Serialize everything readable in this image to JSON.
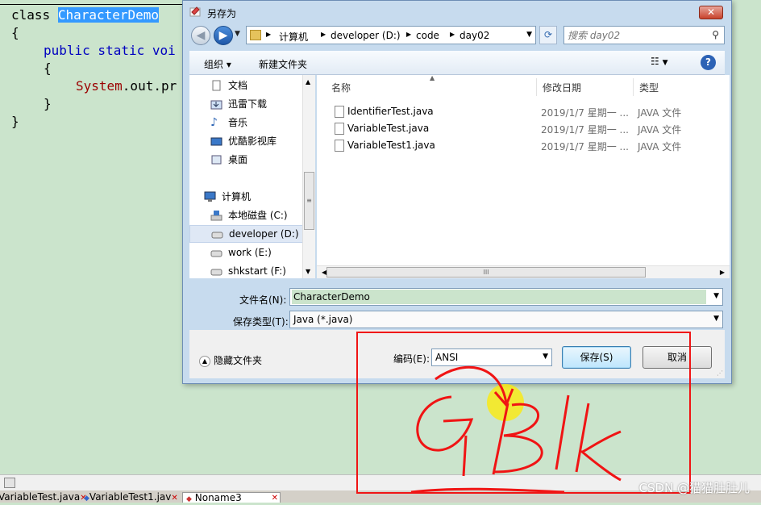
{
  "editor": {
    "line1_kw": "class",
    "line1_name": "CharacterDemo",
    "line2": "{",
    "line3_kw": "public static voi",
    "line4": "{",
    "line5_cls": "System",
    "line5_rest": ".out.pr",
    "line6": "}",
    "line7": "}"
  },
  "tabs": [
    {
      "label": "VariableTest.java"
    },
    {
      "label": "VariableTest1.jav"
    },
    {
      "label": "Noname3"
    }
  ],
  "dialog": {
    "title": "另存为",
    "close_label": "✕",
    "address": {
      "crumbs": [
        "计算机",
        "developer (D:)",
        "code",
        "day02"
      ]
    },
    "search_placeholder": "搜索 day02",
    "toolbar": {
      "organize": "组织 ▾",
      "new_folder": "新建文件夹",
      "help": "?"
    },
    "nav": {
      "favorites": [
        {
          "label": "文档",
          "icon": "documents-icon"
        },
        {
          "label": "迅雷下载",
          "icon": "download-icon"
        },
        {
          "label": "音乐",
          "icon": "music-icon"
        },
        {
          "label": "优酷影视库",
          "icon": "video-icon"
        },
        {
          "label": "桌面",
          "icon": "desktop-icon"
        }
      ],
      "computer": "计算机",
      "drives": [
        {
          "label": "本地磁盘 (C:)"
        },
        {
          "label": "developer (D:)"
        },
        {
          "label": "work (E:)"
        },
        {
          "label": "shkstart (F:)"
        }
      ]
    },
    "columns": {
      "name": "名称",
      "date": "修改日期",
      "type": "类型"
    },
    "files": [
      {
        "name": "IdentifierTest.java",
        "date": "2019/1/7 星期一 ...",
        "type": "JAVA 文件"
      },
      {
        "name": "VariableTest.java",
        "date": "2019/1/7 星期一 ...",
        "type": "JAVA 文件"
      },
      {
        "name": "VariableTest1.java",
        "date": "2019/1/7 星期一 ...",
        "type": "JAVA 文件"
      }
    ],
    "filename_label": "文件名(N):",
    "filename_value": "CharacterDemo",
    "filetype_label": "保存类型(T):",
    "filetype_value": "Java (*.java)",
    "hide_folders": "隐藏文件夹",
    "encoding_label": "编码(E):",
    "encoding_value": "ANSI",
    "save_button": "保存(S)",
    "cancel_button": "取消"
  },
  "annotation": {
    "handwritten": "GBk",
    "color": "#ff0000"
  },
  "watermark": "CSDN @猫猫肚肚儿"
}
